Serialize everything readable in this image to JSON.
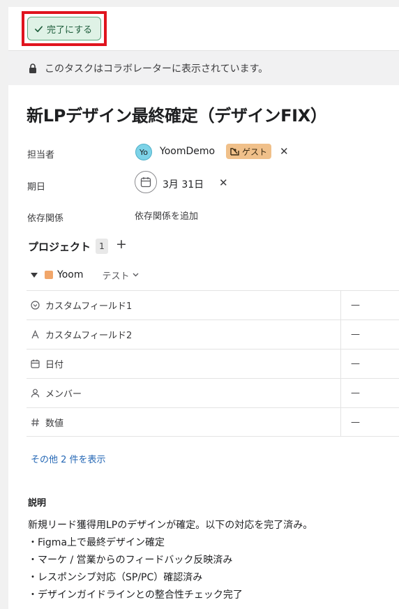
{
  "toolbar": {
    "complete_label": "完了にする"
  },
  "notice": {
    "text": "このタスクはコラボレーターに表示されています。"
  },
  "task": {
    "title": "新LPデザイン最終確定（デザインFIX）"
  },
  "fields": {
    "assignee": {
      "label": "担当者",
      "initials": "Yo",
      "name": "YoomDemo",
      "badge": "ゲスト"
    },
    "due": {
      "label": "期日",
      "value": "3月 31日"
    },
    "dependencies": {
      "label": "依存関係",
      "add_label": "依存関係を追加"
    }
  },
  "projects": {
    "heading": "プロジェクト",
    "count": "1",
    "add_symbol": "+",
    "items": [
      {
        "name": "Yoom",
        "section": "テスト"
      }
    ]
  },
  "custom_fields": [
    {
      "icon": "dropdown-field-icon",
      "name": "カスタムフィールド1",
      "value": "—"
    },
    {
      "icon": "text-field-icon",
      "name": "カスタムフィールド2",
      "value": "—"
    },
    {
      "icon": "calendar-icon",
      "name": "日付",
      "value": "—"
    },
    {
      "icon": "person-icon",
      "name": "メンバー",
      "value": "—"
    },
    {
      "icon": "number-field-icon",
      "name": "数値",
      "value": "—"
    }
  ],
  "show_more": "その他 2 件を表示",
  "description": {
    "heading": "説明",
    "lines": [
      "新規リード獲得用LPのデザインが確定。以下の対応を完了済み。",
      "・Figma上で最終デザイン確定",
      "・マーケ / 営業からのフィードバック反映済み",
      "・レスポンシブ対応（SP/PC）確認済み",
      "・デザインガイドラインとの整合性チェック完了"
    ]
  },
  "colors": {
    "complete_bg": "#dff2e6",
    "complete_border": "#5ba37a",
    "highlight": "#e0141e",
    "guest_badge": "#f0c08a",
    "avatar": "#7dd3e8",
    "project_swatch": "#f1a66a",
    "link": "#2467b5"
  }
}
